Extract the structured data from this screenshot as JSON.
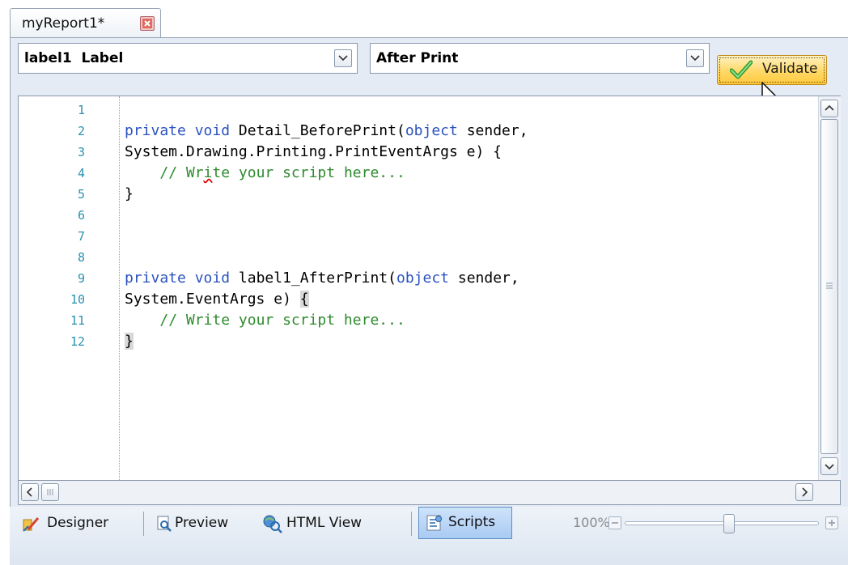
{
  "tab": {
    "title": "myReport1*"
  },
  "toolbar_top": {
    "object_combo": {
      "name": "label1",
      "type": "Label"
    },
    "event_combo": {
      "value": "After Print"
    },
    "validate_label": "Validate"
  },
  "editor": {
    "line_numbers": [
      "1",
      "2",
      "3",
      "4",
      "5",
      "6",
      "7",
      "8",
      "9",
      "10",
      "11",
      "12"
    ],
    "lines": {
      "l2": {
        "kw1": "private",
        "kw2": "void",
        "name": "Detail_BeforePrint(",
        "kw3": "object",
        "rest": "sender,"
      },
      "l3": {
        "text": "System.Drawing.Printing.PrintEventArgs e) {"
      },
      "l4": {
        "pre": "// Wr",
        "squig": "i",
        "post": "te your script here..."
      },
      "l5": {
        "text": "}"
      },
      "l8": {
        "kw1": "private",
        "kw2": "void",
        "name": "label1_AfterPrint(",
        "kw3": "object",
        "rest": "sender,"
      },
      "l9": {
        "pre": "System.EventArgs e) ",
        "brace": "{"
      },
      "l10": {
        "text": "// Write your script here..."
      },
      "l11": {
        "brace": "}"
      }
    }
  },
  "bottom_toolbar": {
    "designer": "Designer",
    "preview": "Preview",
    "html_view": "HTML View",
    "scripts": "Scripts",
    "zoom_text": "100%",
    "zoom_level": 1.0
  },
  "colors": {
    "keyword": "#2a52be",
    "comment": "#2e8b2e",
    "line_number": "#2b91af",
    "validate_bg": "#ffd867"
  },
  "icons": [
    "close-icon",
    "chevron-down-icon",
    "checkmark-icon",
    "mouse-cursor-icon",
    "chevron-up-icon",
    "chevron-left-icon",
    "chevron-right-icon",
    "designer-icon",
    "preview-icon",
    "html-view-icon",
    "scripts-icon"
  ]
}
